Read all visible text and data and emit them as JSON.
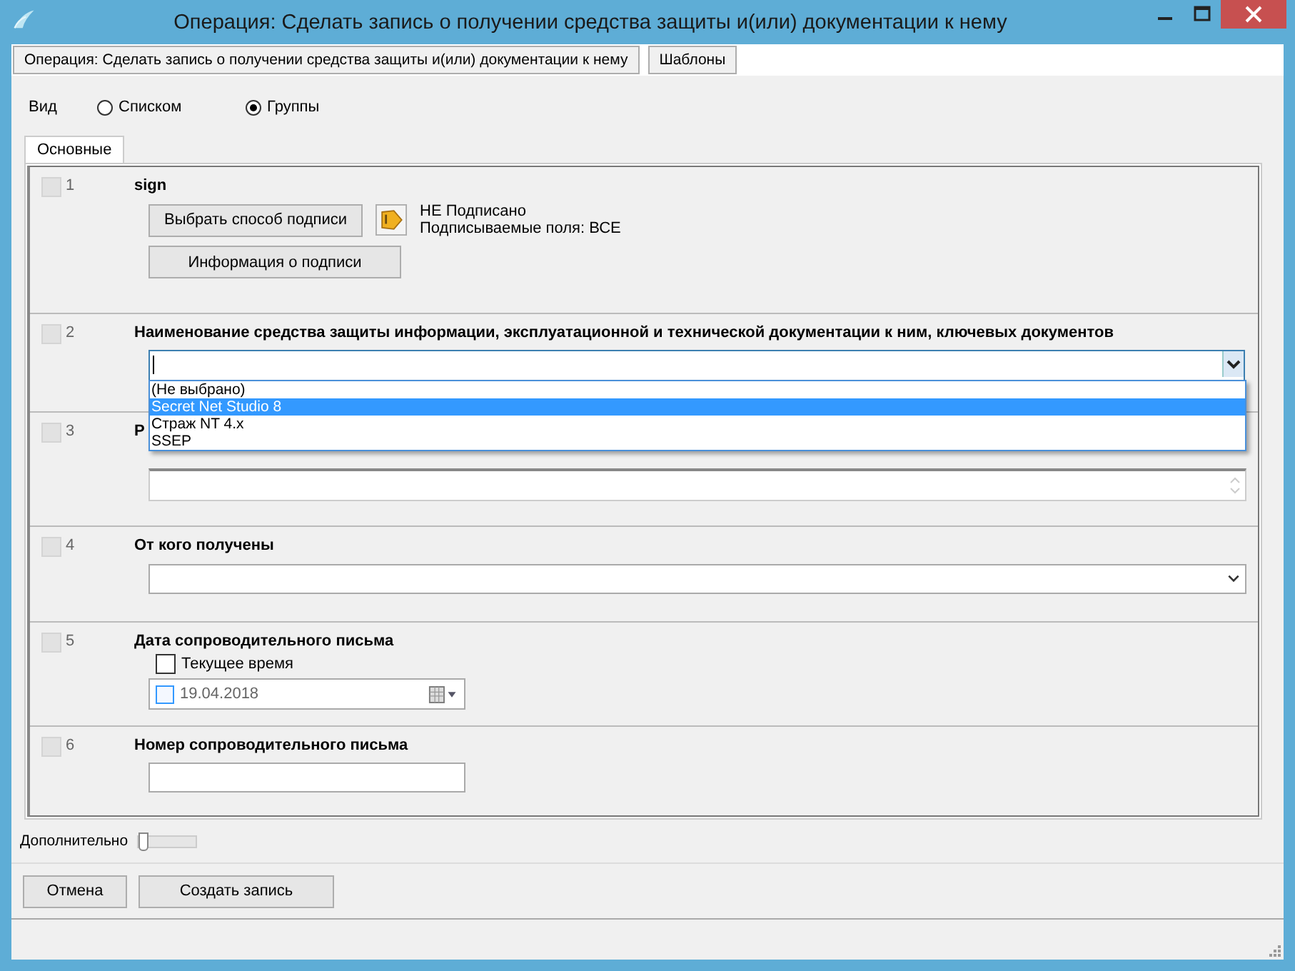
{
  "window": {
    "title": "Операция: Сделать запись о получении средства защиты и(или) документации к нему"
  },
  "toolbar": [
    {
      "label": "Операция: Сделать запись о получении средства защиты и(или) документации к нему"
    },
    {
      "label": "Шаблоны"
    }
  ],
  "view": {
    "label": "Вид",
    "options": [
      {
        "label": "Списком",
        "selected": false
      },
      {
        "label": "Группы",
        "selected": true
      }
    ]
  },
  "tabs": [
    {
      "label": "Основные",
      "selected": true
    }
  ],
  "sections": [
    {
      "kind": "sign",
      "number": "1",
      "checked": false,
      "title": "sign",
      "buttons": [
        "Выбрать способ подписи",
        "Информация о подписи"
      ],
      "status": "НЕ Подписано",
      "fields": "Подписываемые поля: ВСЕ"
    },
    {
      "kind": "combo",
      "number": "2",
      "checked": false,
      "title": "Наименование средства защиты информации, эксплуатационной и технической документации к ним, ключевых документов",
      "options": [
        {
          "label": "(Не выбрано)",
          "selected": false
        },
        {
          "label": "Secret Net Studio 8",
          "selected": true
        },
        {
          "label": "Страж NT 4.x",
          "selected": false
        },
        {
          "label": "SSEP",
          "selected": false
        }
      ]
    },
    {
      "kind": "memo",
      "number": "3",
      "checked": false,
      "title": "Р"
    },
    {
      "kind": "select",
      "number": "4",
      "checked": false,
      "title": "От кого получены"
    },
    {
      "kind": "date",
      "number": "5",
      "checked": false,
      "title": "Дата сопроводительного письма",
      "now_label": "Текущее время",
      "now_checked": false,
      "date": "19.04.2018"
    },
    {
      "kind": "text",
      "number": "6",
      "checked": false,
      "title": "Номер сопроводительного письма"
    }
  ],
  "extra": {
    "label": "Дополнительно",
    "level": 0
  },
  "buttons": [
    "Отмена",
    "Создать запись"
  ]
}
